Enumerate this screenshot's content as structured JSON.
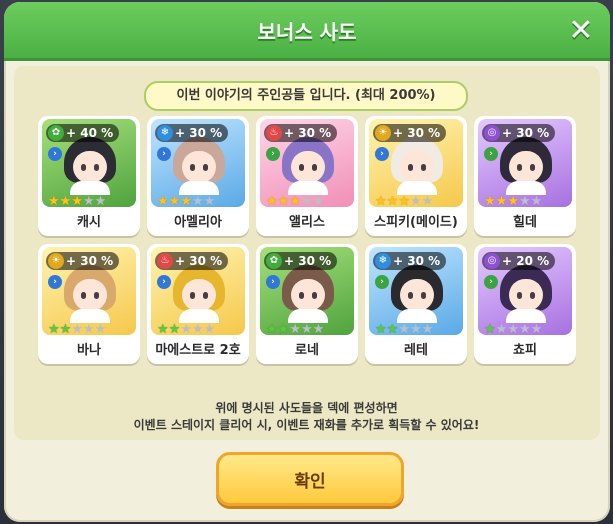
{
  "dialog": {
    "title": "보너스 사도",
    "subtitle": "이번 이야기의 주인공들 입니다. (최대 200%)",
    "footnote_line1": "위에 명시된 사도들을 덱에 편성하면",
    "footnote_line2": "이벤트 스테이지 클리어 시, 이벤트 재화를 추가로 획득할 수 있어요!",
    "confirm_label": "확인"
  },
  "characters": [
    {
      "name": "캐시",
      "bonus": "+ 40 %",
      "element": "grass",
      "class": "blue",
      "stars": 3,
      "star_style": "gold",
      "bg": "green",
      "hair": "#2c2c34"
    },
    {
      "name": "아멜리아",
      "bonus": "+ 30 %",
      "element": "water",
      "class": "blue",
      "stars": 3,
      "star_style": "gold",
      "bg": "blue",
      "hair": "#c9a79a"
    },
    {
      "name": "앨리스",
      "bonus": "+ 30 %",
      "element": "fire",
      "class": "green",
      "stars": 3,
      "star_style": "gold",
      "bg": "pink",
      "hair": "#8a74c8"
    },
    {
      "name": "스피키(메이드)",
      "bonus": "+ 30 %",
      "element": "light",
      "class": "blue",
      "stars": 3,
      "star_style": "gold",
      "bg": "yellow",
      "hair": "#f1ece3"
    },
    {
      "name": "힐데",
      "bonus": "+ 30 %",
      "element": "dark",
      "class": "green",
      "stars": 3,
      "star_style": "gold",
      "bg": "purple",
      "hair": "#2e2a3a"
    },
    {
      "name": "바나",
      "bonus": "+ 30 %",
      "element": "light",
      "class": "blue",
      "stars": 2,
      "star_style": "green",
      "bg": "yellow",
      "hair": "#d8a96b"
    },
    {
      "name": "마에스트로 2호",
      "bonus": "+ 30 %",
      "element": "fire",
      "class": "blue",
      "stars": 2,
      "star_style": "green",
      "bg": "yellow",
      "hair": "#e6b62e"
    },
    {
      "name": "로네",
      "bonus": "+ 30 %",
      "element": "grass",
      "class": "blue",
      "stars": 2,
      "star_style": "green",
      "bg": "green",
      "hair": "#7a5a48"
    },
    {
      "name": "레테",
      "bonus": "+ 30 %",
      "element": "water",
      "class": "green",
      "stars": 2,
      "star_style": "green",
      "bg": "blue",
      "hair": "#2a2a2e"
    },
    {
      "name": "쵸피",
      "bonus": "+ 20 %",
      "element": "dark",
      "class": "green",
      "stars": 1,
      "star_style": "green",
      "bg": "purple",
      "hair": "#3a2a54"
    }
  ],
  "icons": {
    "grass": "✿",
    "water": "❄",
    "fire": "♨",
    "light": "☀",
    "dark": "◎",
    "class": "›",
    "close": "✕"
  }
}
